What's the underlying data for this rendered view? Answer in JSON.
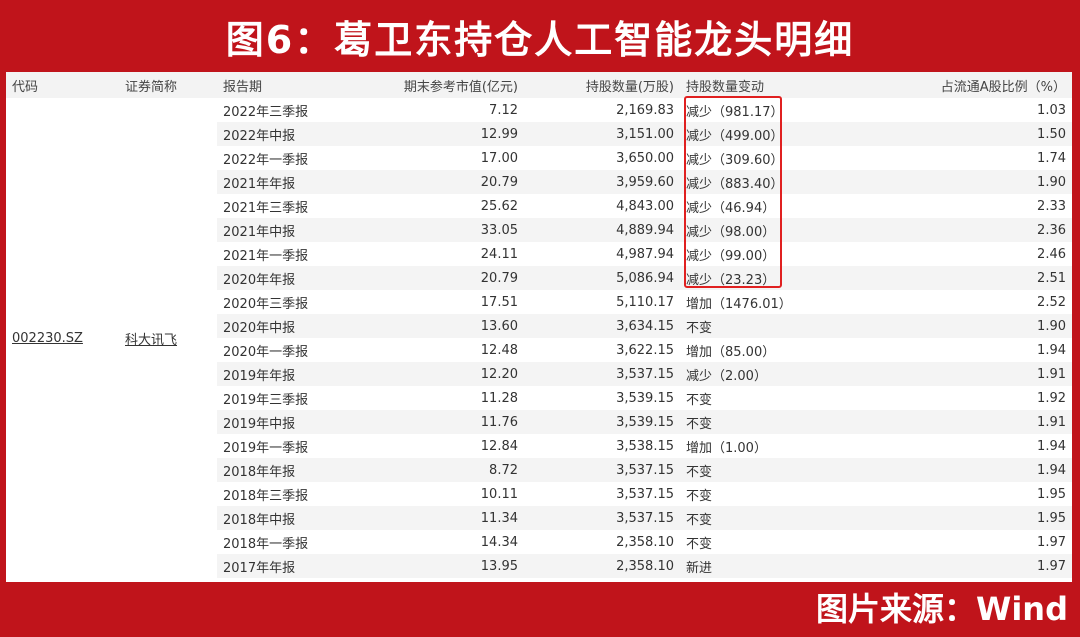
{
  "title": "图6：葛卫东持仓人工智能龙头明细",
  "source": "图片来源：Wind",
  "colors": {
    "background": "#c0141b",
    "highlight": "#e02020"
  },
  "table": {
    "headers": {
      "code": "代码",
      "name": "证券简称",
      "period": "报告期",
      "mktval": "期末参考市值(亿元)",
      "shares": "持股数量(万股)",
      "change": "持股数量变动",
      "ratio": "占流通A股比例（%）"
    },
    "code": "002230.SZ",
    "name": "科大讯飞",
    "rows": [
      {
        "period": "2022年三季报",
        "mktval": "7.12",
        "shares": "2,169.83",
        "change": "减少（981.17）",
        "ratio": "1.03"
      },
      {
        "period": "2022年中报",
        "mktval": "12.99",
        "shares": "3,151.00",
        "change": "减少（499.00）",
        "ratio": "1.50"
      },
      {
        "period": "2022年一季报",
        "mktval": "17.00",
        "shares": "3,650.00",
        "change": "减少（309.60）",
        "ratio": "1.74"
      },
      {
        "period": "2021年年报",
        "mktval": "20.79",
        "shares": "3,959.60",
        "change": "减少（883.40）",
        "ratio": "1.90"
      },
      {
        "period": "2021年三季报",
        "mktval": "25.62",
        "shares": "4,843.00",
        "change": "减少（46.94）",
        "ratio": "2.33"
      },
      {
        "period": "2021年中报",
        "mktval": "33.05",
        "shares": "4,889.94",
        "change": "减少（98.00）",
        "ratio": "2.36"
      },
      {
        "period": "2021年一季报",
        "mktval": "24.11",
        "shares": "4,987.94",
        "change": "减少（99.00）",
        "ratio": "2.46"
      },
      {
        "period": "2020年年报",
        "mktval": "20.79",
        "shares": "5,086.94",
        "change": "减少（23.23）",
        "ratio": "2.51"
      },
      {
        "period": "2020年三季报",
        "mktval": "17.51",
        "shares": "5,110.17",
        "change": "增加（1476.01）",
        "ratio": "2.52"
      },
      {
        "period": "2020年中报",
        "mktval": "13.60",
        "shares": "3,634.15",
        "change": "不变",
        "ratio": "1.90"
      },
      {
        "period": "2020年一季报",
        "mktval": "12.48",
        "shares": "3,622.15",
        "change": "增加（85.00）",
        "ratio": "1.94"
      },
      {
        "period": "2019年年报",
        "mktval": "12.20",
        "shares": "3,537.15",
        "change": "减少（2.00）",
        "ratio": "1.91"
      },
      {
        "period": "2019年三季报",
        "mktval": "11.28",
        "shares": "3,539.15",
        "change": "不变",
        "ratio": "1.92"
      },
      {
        "period": "2019年中报",
        "mktval": "11.76",
        "shares": "3,539.15",
        "change": "不变",
        "ratio": "1.91"
      },
      {
        "period": "2019年一季报",
        "mktval": "12.84",
        "shares": "3,538.15",
        "change": "增加（1.00）",
        "ratio": "1.94"
      },
      {
        "period": "2018年年报",
        "mktval": "8.72",
        "shares": "3,537.15",
        "change": "不变",
        "ratio": "1.94"
      },
      {
        "period": "2018年三季报",
        "mktval": "10.11",
        "shares": "3,537.15",
        "change": "不变",
        "ratio": "1.95"
      },
      {
        "period": "2018年中报",
        "mktval": "11.34",
        "shares": "3,537.15",
        "change": "不变",
        "ratio": "1.95"
      },
      {
        "period": "2018年一季报",
        "mktval": "14.34",
        "shares": "2,358.10",
        "change": "不变",
        "ratio": "1.97"
      },
      {
        "period": "2017年年报",
        "mktval": "13.95",
        "shares": "2,358.10",
        "change": "新进",
        "ratio": "1.97"
      }
    ]
  }
}
